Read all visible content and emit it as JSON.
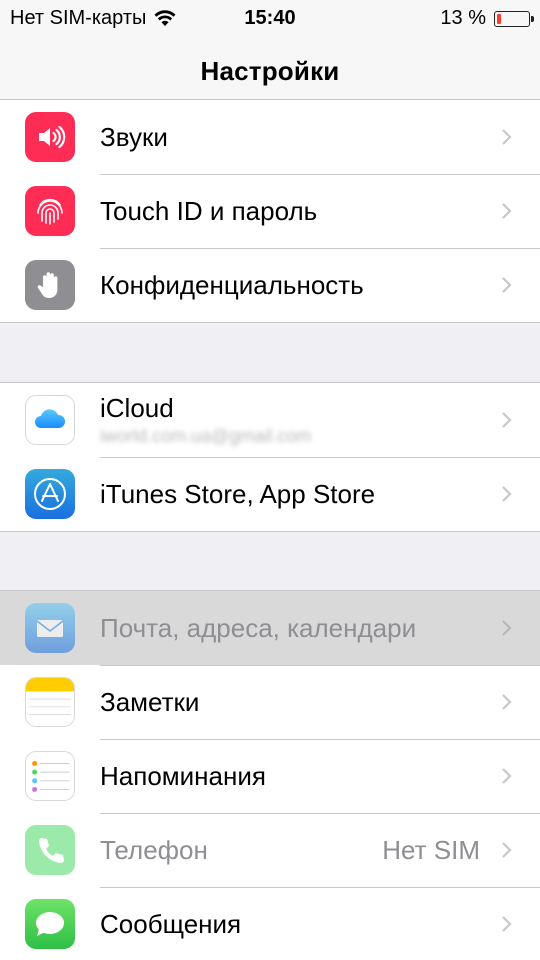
{
  "status_bar": {
    "carrier": "Нет SIM-карты",
    "time": "15:40",
    "battery_percent_text": "13 %",
    "battery_level": 0.13,
    "battery_color": "#ff3b30",
    "wifi_icon": "wifi-icon"
  },
  "navbar": {
    "title": "Настройки"
  },
  "groups": [
    {
      "items": [
        {
          "id": "sounds",
          "label": "Звуки",
          "icon": "speaker-icon",
          "icon_color": "#ff2d55"
        },
        {
          "id": "touch-id",
          "label": "Touch ID и пароль",
          "icon": "fingerprint-icon",
          "icon_color": "#ff2d55"
        },
        {
          "id": "privacy",
          "label": "Конфиденциальность",
          "icon": "hand-icon",
          "icon_color": "#8e8e93"
        }
      ]
    },
    {
      "items": [
        {
          "id": "icloud",
          "label": "iCloud",
          "sublabel": "iworld.com.ua@gmail.com",
          "icon": "cloud-icon",
          "icon_color": "#ffffff"
        },
        {
          "id": "itunes",
          "label": "iTunes Store, App Store",
          "icon": "app-store-icon",
          "icon_color": "#1a8cff"
        }
      ]
    },
    {
      "items": [
        {
          "id": "mail",
          "label": "Почта, адреса, календари",
          "icon": "mail-icon",
          "icon_color": "#1a8cff",
          "highlighted": true
        },
        {
          "id": "notes",
          "label": "Заметки",
          "icon": "notes-icon",
          "icon_color": "#ffcc00"
        },
        {
          "id": "reminders",
          "label": "Напоминания",
          "icon": "reminders-icon",
          "icon_color": "#ffffff"
        },
        {
          "id": "phone",
          "label": "Телефон",
          "value": "Нет SIM",
          "icon": "phone-icon",
          "icon_color": "#4cd964",
          "dimmed": true
        },
        {
          "id": "messages",
          "label": "Сообщения",
          "icon": "messages-icon",
          "icon_color": "#4cd964"
        }
      ]
    }
  ]
}
